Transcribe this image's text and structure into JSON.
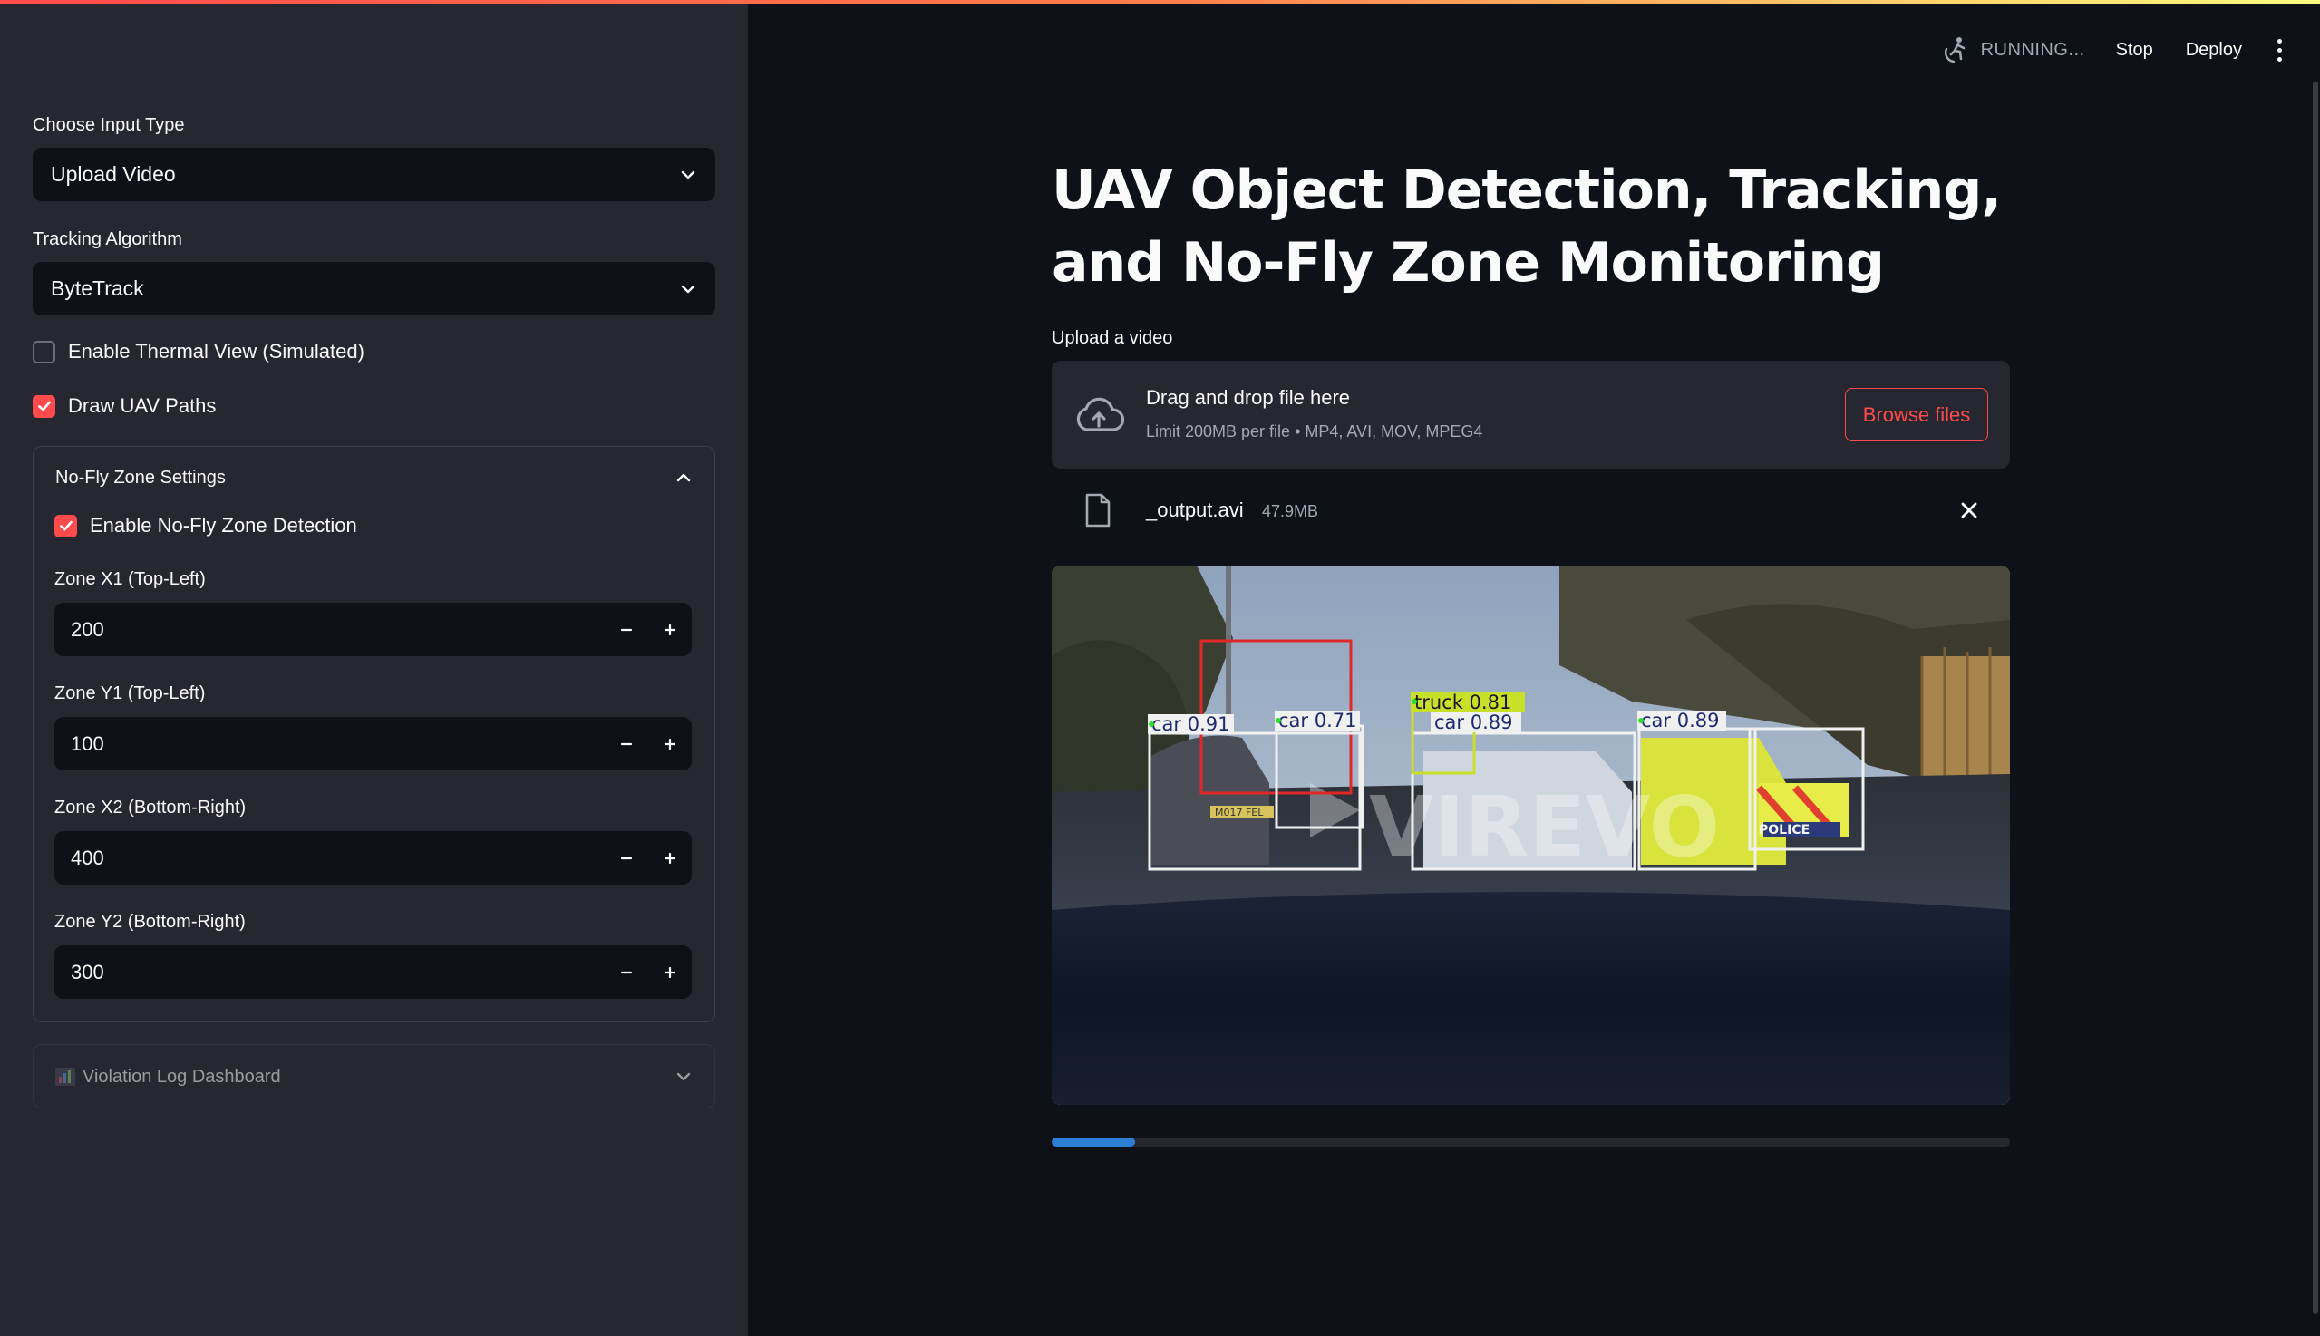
{
  "sidebar": {
    "input_type": {
      "label": "Choose Input Type",
      "value": "Upload Video"
    },
    "tracking": {
      "label": "Tracking Algorithm",
      "value": "ByteTrack"
    },
    "thermal": {
      "label": "Enable Thermal View (Simulated)",
      "checked": false
    },
    "uav_paths": {
      "label": "Draw UAV Paths",
      "checked": true
    },
    "nofly": {
      "title": "No-Fly Zone Settings",
      "enable": {
        "label": "Enable No-Fly Zone Detection",
        "checked": true
      },
      "x1": {
        "label": "Zone X1 (Top-Left)",
        "value": "200"
      },
      "y1": {
        "label": "Zone Y1 (Top-Left)",
        "value": "100"
      },
      "x2": {
        "label": "Zone X2 (Bottom-Right)",
        "value": "400"
      },
      "y2": {
        "label": "Zone Y2 (Bottom-Right)",
        "value": "300"
      }
    },
    "violation": {
      "title": "Violation Log Dashboard"
    }
  },
  "header": {
    "status": "RUNNING...",
    "stop": "Stop",
    "deploy": "Deploy"
  },
  "main": {
    "title": "UAV Object Detection, Tracking, and No-Fly Zone Monitoring",
    "uploader": {
      "label": "Upload a video",
      "drag_text": "Drag and drop file here",
      "limit_text": "Limit 200MB per file • MP4, AVI, MOV, MPEG4",
      "browse": "Browse files"
    },
    "file": {
      "name": "_output.avi",
      "size": "47.9MB"
    },
    "detections": [
      {
        "label": "car 0.91"
      },
      {
        "label": "car 0.71"
      },
      {
        "label": "truck 0.81"
      },
      {
        "label": "car 0.89"
      },
      {
        "label": "car 0.89"
      }
    ],
    "watermark": "VIREVO",
    "police_text": "POLICE",
    "plate_text": "M017 FEL",
    "progress": 0.087
  },
  "colors": {
    "accent": "#ff4b4b",
    "progress": "#2e80d6",
    "sidebar_bg": "#262730",
    "main_bg": "#0e1117"
  }
}
